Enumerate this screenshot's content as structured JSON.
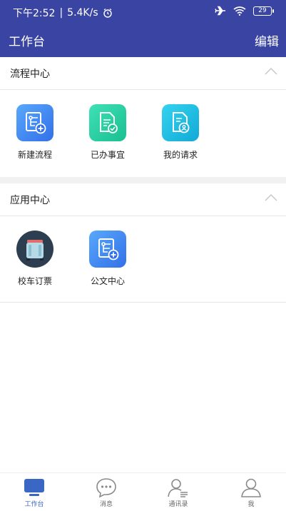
{
  "status_bar": {
    "time": "下午2:52",
    "speed": "5.4K/s",
    "battery": "29"
  },
  "header": {
    "title": "工作台",
    "edit_label": "编辑"
  },
  "sections": [
    {
      "title": "流程中心",
      "items": [
        {
          "label": "新建流程",
          "icon": "new-flow-icon",
          "color": "#3f8ef5"
        },
        {
          "label": "已办事宜",
          "icon": "done-items-icon",
          "color": "#2fd1a5"
        },
        {
          "label": "我的请求",
          "icon": "my-requests-icon",
          "color": "#1fc1e6"
        }
      ]
    },
    {
      "title": "应用中心",
      "items": [
        {
          "label": "校车订票",
          "icon": "school-bus-icon",
          "color": "#2d3e50"
        },
        {
          "label": "公文中心",
          "icon": "document-center-icon",
          "color": "#3f8ef5"
        }
      ]
    }
  ],
  "tabbar": {
    "active_color": "#3a66c4",
    "tabs": [
      {
        "label": "工作台",
        "icon": "workbench-icon",
        "active": true
      },
      {
        "label": "消息",
        "icon": "message-icon",
        "active": false
      },
      {
        "label": "通讯录",
        "icon": "contacts-icon",
        "active": false
      },
      {
        "label": "我",
        "icon": "profile-icon",
        "active": false
      }
    ]
  }
}
